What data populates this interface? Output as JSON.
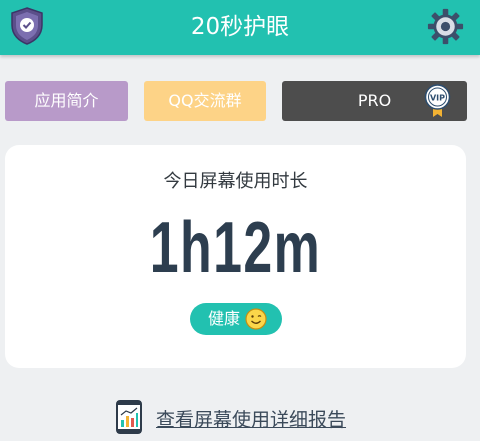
{
  "header": {
    "title": "20秒护眼"
  },
  "buttons": {
    "intro_label": "应用简介",
    "qq_label": "QQ交流群",
    "pro_label": "PRO",
    "pro_badge": "VIP"
  },
  "card": {
    "label": "今日屏幕使用时长",
    "time": "1h12m",
    "status": "健康"
  },
  "report": {
    "link_label": "查看屏幕使用详细报告"
  },
  "icons": {
    "header_left": "shield-check-icon",
    "header_right": "gear-icon",
    "pro_badge": "vip-badge-icon",
    "status": "smiley-icon",
    "report": "phone-chart-icon"
  },
  "colors": {
    "accent": "#22c1b0",
    "intro_button": "#b89ac9",
    "qq_button": "#fdd387",
    "pro_button": "#4d4d4d"
  }
}
